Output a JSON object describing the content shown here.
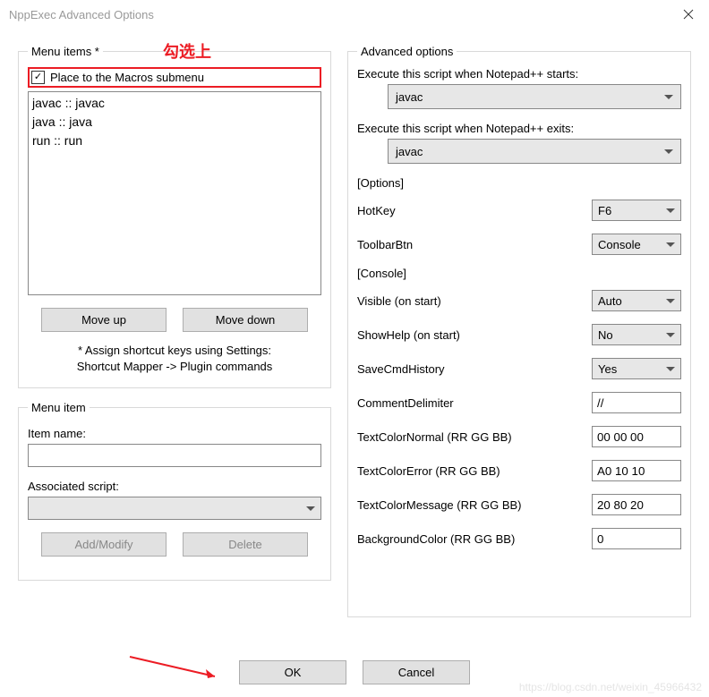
{
  "window": {
    "title": "NppExec Advanced Options"
  },
  "annotation": {
    "text": "勾选上"
  },
  "left": {
    "menuItemsLegend": "Menu items *",
    "placeCheckboxLabel": "Place to the Macros submenu",
    "placeChecked": "✓",
    "listItems": [
      "javac :: javac",
      "java :: java",
      "run :: run"
    ],
    "moveUp": "Move up",
    "moveDown": "Move down",
    "hintLine1": "* Assign shortcut keys using Settings:",
    "hintLine2": "Shortcut Mapper -> Plugin commands",
    "menuItemLegend": "Menu item",
    "itemNameLabel": "Item name:",
    "itemNameValue": "",
    "assocScriptLabel": "Associated script:",
    "assocScriptValue": "",
    "addModify": "Add/Modify",
    "delete": "Delete"
  },
  "right": {
    "advOptionsLegend": "Advanced options",
    "startLabel": "Execute this script when Notepad++ starts:",
    "startValue": "javac",
    "exitLabel": "Execute this script when Notepad++ exits:",
    "exitValue": "javac",
    "optionsHeader": "[Options]",
    "hotkeyLabel": "HotKey",
    "hotkeyValue": "F6",
    "toolbarLabel": "ToolbarBtn",
    "toolbarValue": "Console",
    "consoleHeader": "[Console]",
    "visibleLabel": "Visible (on start)",
    "visibleValue": "Auto",
    "showHelpLabel": "ShowHelp (on start)",
    "showHelpValue": "No",
    "saveCmdLabel": "SaveCmdHistory",
    "saveCmdValue": "Yes",
    "commentDelimLabel": "CommentDelimiter",
    "commentDelimValue": "//",
    "colorNormalLabel": "TextColorNormal (RR GG BB)",
    "colorNormalValue": "00 00 00",
    "colorErrorLabel": "TextColorError (RR GG BB)",
    "colorErrorValue": "A0 10 10",
    "colorMsgLabel": "TextColorMessage (RR GG BB)",
    "colorMsgValue": "20 80 20",
    "bgColorLabel": "BackgroundColor (RR GG BB)",
    "bgColorValue": "0"
  },
  "footer": {
    "ok": "OK",
    "cancel": "Cancel"
  },
  "watermark": "https://blog.csdn.net/weixin_45966432"
}
